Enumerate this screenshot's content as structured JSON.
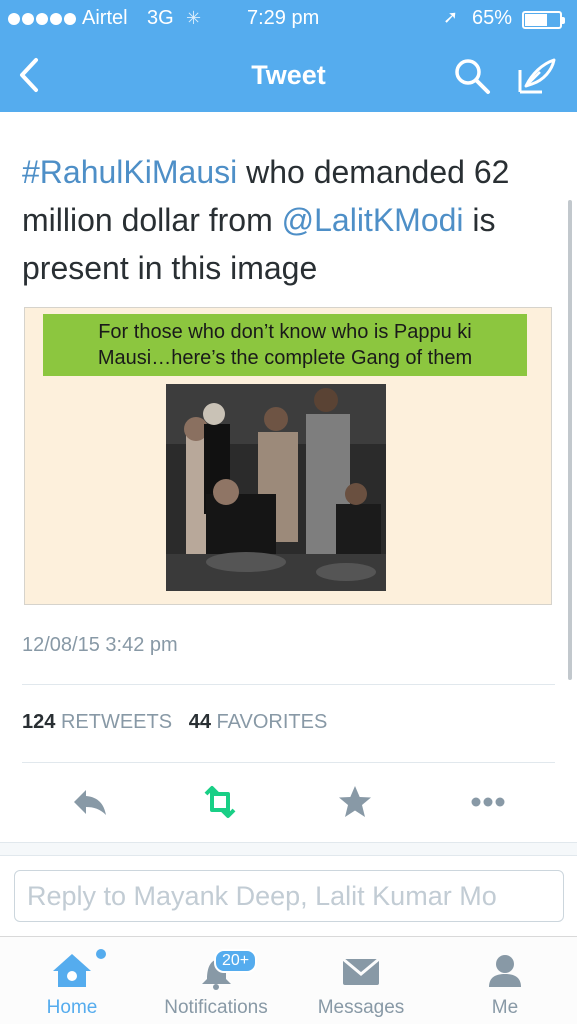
{
  "status_bar": {
    "carrier": "Airtel",
    "network": "3G",
    "time": "7:29 pm",
    "battery_percent_text": "65%",
    "battery_level": 0.65,
    "signal_bars": 5
  },
  "nav": {
    "title": "Tweet"
  },
  "tweet": {
    "hashtag": "#RahulKiMausi",
    "text_part1": " who demanded 62 million dollar from ",
    "mention": "@LalitKModi",
    "text_part2": " is present in this image",
    "image_banner_line1": "For those who don’t know who is Pappu ki",
    "image_banner_line2": "Mausi…here’s the complete Gang of them",
    "timestamp": "12/08/15 3:42 pm",
    "retweet_count": "124",
    "retweet_label": "RETWEETS",
    "favorite_count": "44",
    "favorite_label": "FAVORITES"
  },
  "actions": {
    "reply_icon": "reply-icon",
    "retweet_icon": "retweet-icon",
    "favorite_icon": "star-icon",
    "more_icon": "more-dots-icon"
  },
  "reply": {
    "placeholder": "Reply to Mayank Deep, Lalit Kumar Mo"
  },
  "tabs": [
    {
      "label": "Home",
      "icon": "home-icon",
      "active": true
    },
    {
      "label": "Notifications",
      "icon": "bell-icon",
      "badge": "20+"
    },
    {
      "label": "Messages",
      "icon": "envelope-icon"
    },
    {
      "label": "Me",
      "icon": "person-icon"
    }
  ],
  "colors": {
    "brand_blue": "#55acee",
    "link_blue": "#4e8fc7",
    "retweet_green": "#19cf86",
    "muted_gray": "#8899a6",
    "banner_green": "#8cc63f"
  }
}
